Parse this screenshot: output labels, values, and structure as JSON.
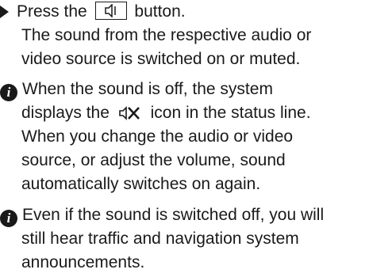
{
  "step": {
    "line1_before": "Press the",
    "line1_after": "button.",
    "line2": "The sound from the respective audio or",
    "line3": "video source is switched on or muted."
  },
  "note1": {
    "line1": "When the sound is off, the system",
    "line2_before": "displays the",
    "line2_after": "icon in the status line.",
    "line3": "When you change the audio or video",
    "line4": "source, or adjust the volume, sound",
    "line5": "automatically switches on again."
  },
  "note2": {
    "line1": "Even if the sound is switched off, you will",
    "line2": "still hear traffic and navigation system",
    "line3": "announcements."
  },
  "icons": {
    "step_bullet": "arrow-bullet-icon",
    "mute_key": "speaker-mute-key-icon",
    "info": "info-icon",
    "status_mute": "muted-speaker-icon",
    "info_glyph": "i"
  }
}
